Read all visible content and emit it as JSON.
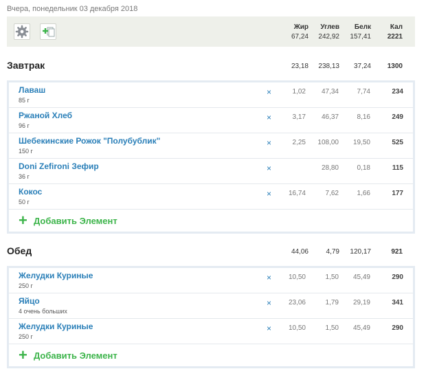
{
  "date_label": "Вчера, понедельник 03 декабря 2018",
  "columns": {
    "fat": "Жир",
    "carbs": "Углев",
    "protein": "Белк",
    "calories": "Кал"
  },
  "totals": {
    "fat": "67,24",
    "carbs": "242,92",
    "protein": "157,41",
    "calories": "2221"
  },
  "toolbar": {
    "settings_icon": "gear-icon",
    "add_icon": "add-copy-icon"
  },
  "colors": {
    "accent": "#2a7fb8",
    "add": "#3cb44a",
    "bar_bg": "#eef0ea"
  },
  "meals": [
    {
      "title": "Завтрак",
      "totals": {
        "fat": "23,18",
        "carbs": "238,13",
        "protein": "37,24",
        "calories": "1300"
      },
      "items": [
        {
          "name": "Лаваш",
          "qty": "85 г",
          "fat": "1,02",
          "carbs": "47,34",
          "protein": "7,74",
          "calories": "234"
        },
        {
          "name": "Ржаной Хлеб",
          "qty": "96 г",
          "fat": "3,17",
          "carbs": "46,37",
          "protein": "8,16",
          "calories": "249"
        },
        {
          "name": "Шебекинские Рожок \"Полубублик\"",
          "qty": "150 г",
          "fat": "2,25",
          "carbs": "108,00",
          "protein": "19,50",
          "calories": "525"
        },
        {
          "name": "Doni Zefironi Зефир",
          "qty": "36 г",
          "fat": "",
          "carbs": "28,80",
          "protein": "0,18",
          "calories": "115"
        },
        {
          "name": "Кокос",
          "qty": "50 г",
          "fat": "16,74",
          "carbs": "7,62",
          "protein": "1,66",
          "calories": "177"
        }
      ],
      "add_label": "Добавить Элемент"
    },
    {
      "title": "Обед",
      "totals": {
        "fat": "44,06",
        "carbs": "4,79",
        "protein": "120,17",
        "calories": "921"
      },
      "items": [
        {
          "name": "Желудки Куриные",
          "qty": "250 г",
          "fat": "10,50",
          "carbs": "1,50",
          "protein": "45,49",
          "calories": "290"
        },
        {
          "name": "Яйцо",
          "qty": "4 очень больших",
          "fat": "23,06",
          "carbs": "1,79",
          "protein": "29,19",
          "calories": "341"
        },
        {
          "name": "Желудки Куриные",
          "qty": "250 г",
          "fat": "10,50",
          "carbs": "1,50",
          "protein": "45,49",
          "calories": "290"
        }
      ],
      "add_label": "Добавить Элемент"
    }
  ],
  "delete_glyph": "×",
  "add_glyph": "+"
}
